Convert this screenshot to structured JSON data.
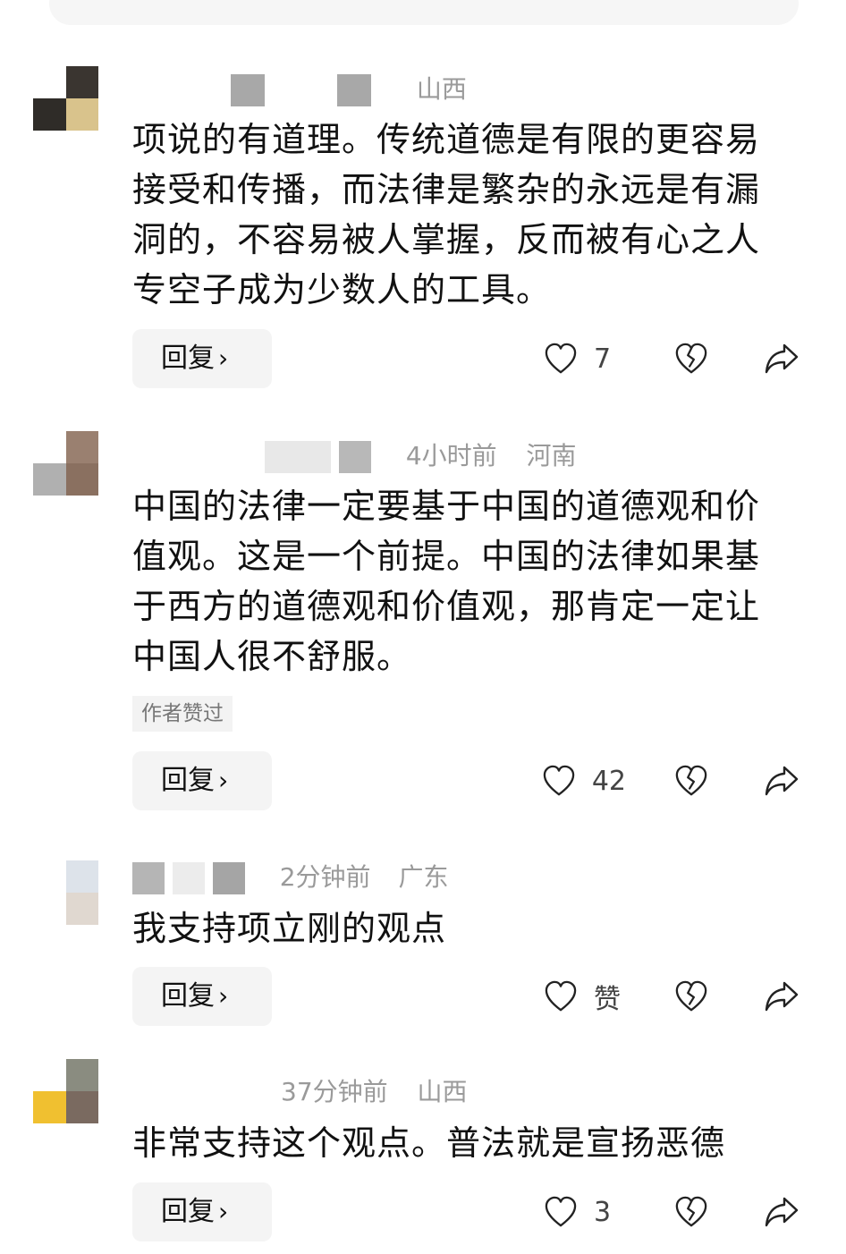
{
  "comments": [
    {
      "time": "",
      "location": "山西",
      "text": "项说的有道理。传统道德是有限的更容易接受和传播，而法律是繁杂的永远是有漏洞的，不容易被人掌握，反而被有心之人专空子成为少数人的工具。",
      "badge": "",
      "reply_label": "回复",
      "like_count": "7"
    },
    {
      "time": "4小时前",
      "location": "河南",
      "text": "中国的法律一定要基于中国的道德观和价值观。这是一个前提。中国的法律如果基于西方的道德观和价值观，那肯定一定让中国人很不舒服。",
      "badge": "作者赞过",
      "reply_label": "回复",
      "like_count": "42"
    },
    {
      "time": "2分钟前",
      "location": "广东",
      "text": "我支持项立刚的观点",
      "badge": "",
      "reply_label": "回复",
      "like_count": "赞"
    },
    {
      "time": "37分钟前",
      "location": "山西",
      "text": "非常支持这个观点。普法就是宣扬恶德",
      "badge": "",
      "reply_label": "回复",
      "like_count": "3"
    }
  ],
  "colors": {
    "text": "#111111",
    "meta": "#9a9a9a",
    "button_bg": "#f4f4f4",
    "badge_bg": "#f3f3f3"
  },
  "icons": [
    "heart-icon",
    "broken-heart-icon",
    "share-icon",
    "chevron-right-icon"
  ]
}
